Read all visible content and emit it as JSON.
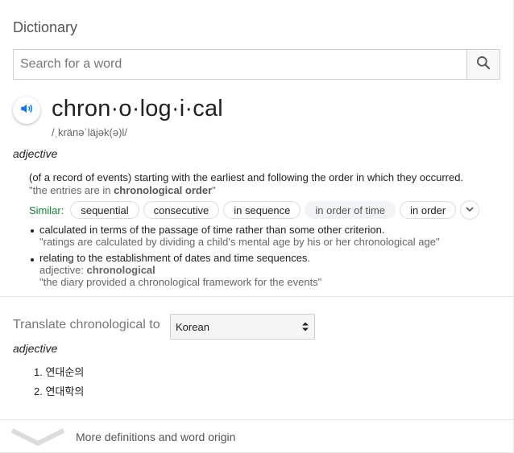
{
  "header": {
    "title": "Dictionary"
  },
  "search": {
    "placeholder": "Search for a word",
    "value": ""
  },
  "entry": {
    "headword": "chron·o·log·i·cal",
    "phonetic": "/ˌkränəˈläjək(ə)l/",
    "part_of_speech": "adjective",
    "senses": [
      {
        "definition": "(of a record of events) starting with the earliest and following the order in which they occurred.",
        "example_pre": "\"the entries are in ",
        "example_bold": "chronological order",
        "example_post": "\"",
        "similar_label": "Similar:",
        "similar": [
          "sequential",
          "consecutive",
          "in sequence",
          "in order of time",
          "in order"
        ]
      }
    ],
    "subsenses": [
      {
        "definition": "calculated in terms of the passage of time rather than some other criterion.",
        "example": "\"ratings are calculated by dividing a child's mental age by his or her chronological age\""
      },
      {
        "definition": "relating to the establishment of dates and time sequences.",
        "form_label": "adjective: ",
        "form_word": "chronological",
        "example": "\"the diary provided a chronological framework for the events\""
      }
    ]
  },
  "translate": {
    "label": "Translate chronological to",
    "language": "Korean",
    "part_of_speech": "adjective",
    "items": [
      "1. 연대순의",
      "2. 연대학의"
    ]
  },
  "footer": {
    "more_label": "More definitions and word origin"
  },
  "icons": {
    "search": "search-icon",
    "speaker": "speaker-icon",
    "expand": "chevron-down-icon",
    "select": "updown-arrows-icon",
    "more": "chevron-down-icon"
  },
  "colors": {
    "similar_label": "#188038",
    "speaker": "#1a73e8"
  }
}
